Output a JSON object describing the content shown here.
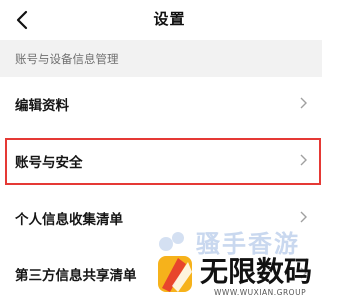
{
  "header": {
    "title": "设置",
    "back_icon": "chevron-left-icon"
  },
  "section": {
    "title": "账号与设备信息管理"
  },
  "rows": [
    {
      "label": "编辑资料",
      "icon": "chevron-right-icon"
    },
    {
      "label": "账号与安全",
      "icon": "chevron-right-icon",
      "highlighted": true
    },
    {
      "label": "个人信息收集清单",
      "icon": "chevron-right-icon"
    },
    {
      "label": "第三方信息共享清单",
      "icon": "chevron-right-icon"
    }
  ],
  "watermark": {
    "faded_text": "骚手香游",
    "brand": "无限数码",
    "domain": "WWW.WUXIAN.GROUP"
  },
  "colors": {
    "highlight_border": "#e53935",
    "section_bg": "#f2f2f2",
    "chevron": "#a0a0a0"
  }
}
